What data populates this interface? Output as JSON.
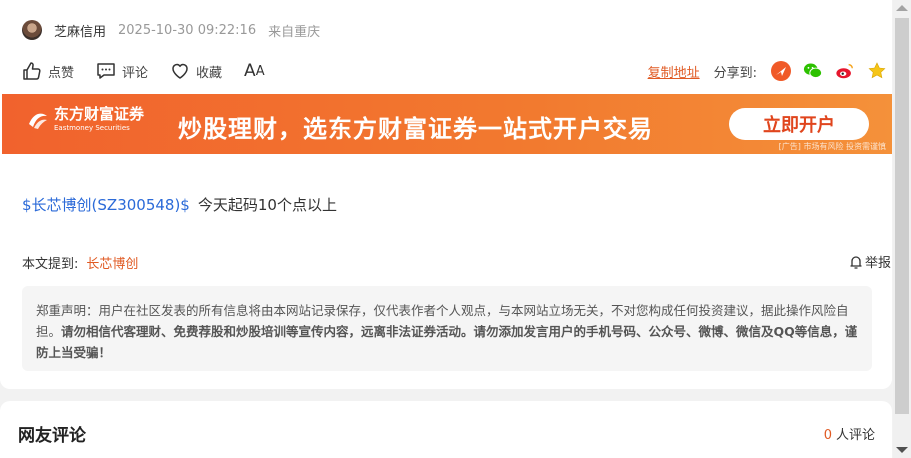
{
  "author": {
    "name": "芝麻信用",
    "time": "2025-10-30 09:22:16",
    "source": "来自重庆"
  },
  "actions": {
    "like": "点赞",
    "comment": "评论",
    "favorite": "收藏",
    "font_big": "A",
    "font_small": "A"
  },
  "share": {
    "copy_link": "复制地址",
    "label": "分享到:"
  },
  "banner": {
    "logo_cn": "东方财富证券",
    "logo_en": "Eastmoney Securities",
    "slogan": "炒股理财，选东方财富证券一站式开户交易",
    "cta": "立即开户",
    "disclaimer": "[广告] 市场有风险 投资需谨慎"
  },
  "post": {
    "stock_link": "$长芯博创(SZ300548)$",
    "text": "今天起码10个点以上"
  },
  "mentions": {
    "label": "本文提到:",
    "stock": "长芯博创"
  },
  "report": "举报",
  "disclaimer": {
    "normal": "郑重声明：用户在社区发表的所有信息将由本网站记录保存，仅代表作者个人观点，与本网站立场无关，不对您构成任何投资建议，据此操作风险自担。",
    "bold": "请勿相信代客理财、免费荐股和炒股培训等宣传内容，远离非法证券活动。请勿添加发言用户的手机号码、公众号、微博、微信及QQ等信息，谨防上当受骗！"
  },
  "comments": {
    "title": "网友评论",
    "count": "0",
    "count_suffix": "人评论"
  },
  "colors": {
    "accent": "#e05a23",
    "link": "#2b6ad8",
    "banner": "#f1622d"
  }
}
